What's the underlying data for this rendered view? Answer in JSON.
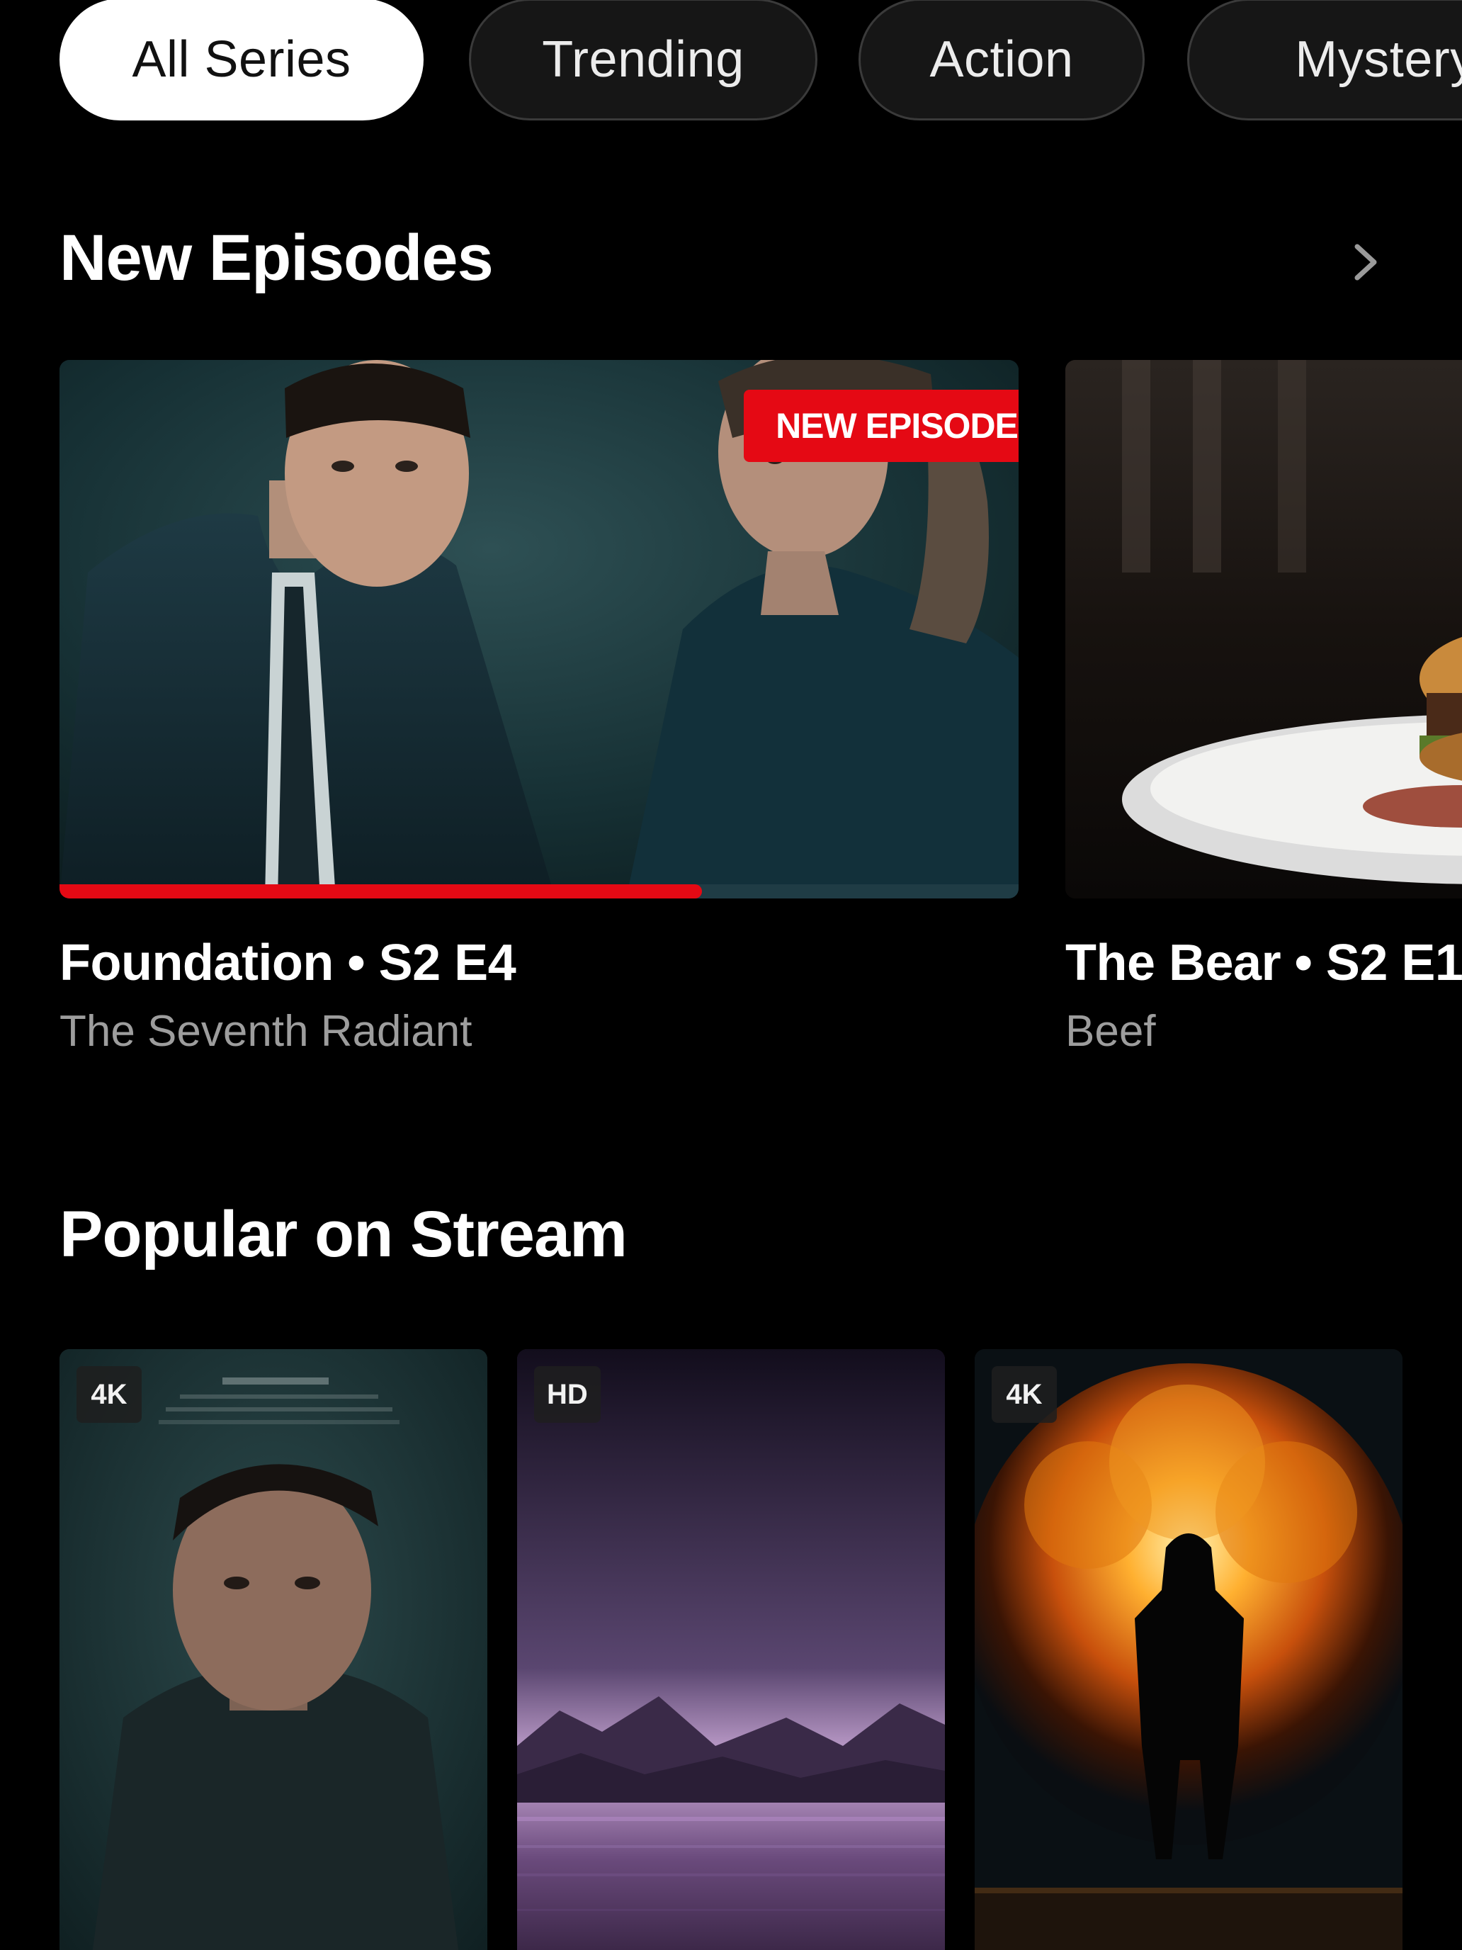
{
  "chips": [
    {
      "label": "All Series",
      "active": true
    },
    {
      "label": "Trending",
      "active": false
    },
    {
      "label": "Action",
      "active": false
    },
    {
      "label": "Mystery",
      "active": false
    }
  ],
  "sections": {
    "new_episodes": {
      "title": "New Episodes",
      "nav_icon": "chevron-right-icon"
    },
    "popular": {
      "title": "Popular on Stream"
    }
  },
  "episodes": [
    {
      "title": "Foundation • S2 E4",
      "subtitle": "The Seventh Radiant",
      "badge": "NEW EPISODE",
      "progress": 0.67
    },
    {
      "title": "The Bear • S2 E1",
      "subtitle": "Beef"
    }
  ],
  "posters": [
    {
      "quality": "4K"
    },
    {
      "quality": "HD"
    },
    {
      "quality": "4K"
    }
  ],
  "colors": {
    "accent": "#e50914",
    "background": "#000000",
    "chip_active": "#ffffff",
    "subtitle": "#9d9d9d"
  }
}
